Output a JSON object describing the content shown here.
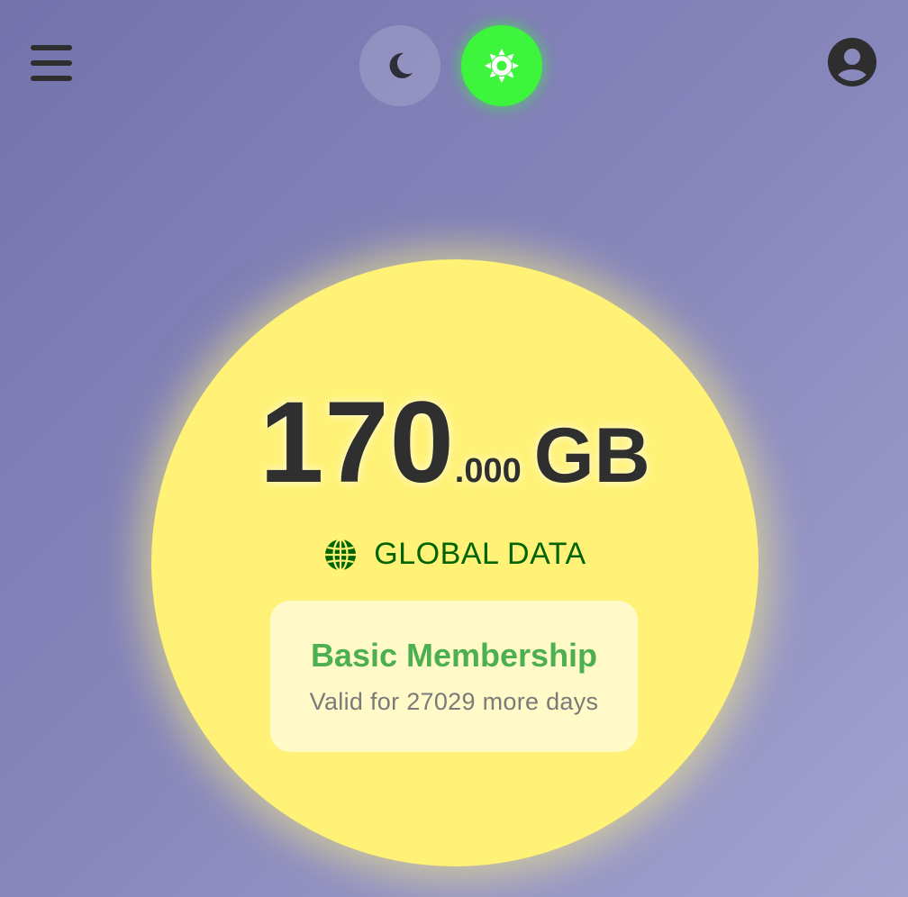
{
  "header": {
    "menu_icon": "hamburger-menu-icon",
    "theme_toggle": {
      "dark_icon": "moon-icon",
      "light_icon": "sun-icon",
      "active": "light",
      "active_color": "#3df53d"
    },
    "account_icon": "account-circle-icon"
  },
  "balance": {
    "amount_integer": "170",
    "amount_decimal": ".000",
    "unit": "GB",
    "data_type_icon": "globe-icon",
    "data_type_label": "GLOBAL DATA",
    "orb_color": "#fff276"
  },
  "membership": {
    "title": "Basic Membership",
    "validity": "Valid for 27029 more days",
    "title_color": "#4caf50"
  }
}
